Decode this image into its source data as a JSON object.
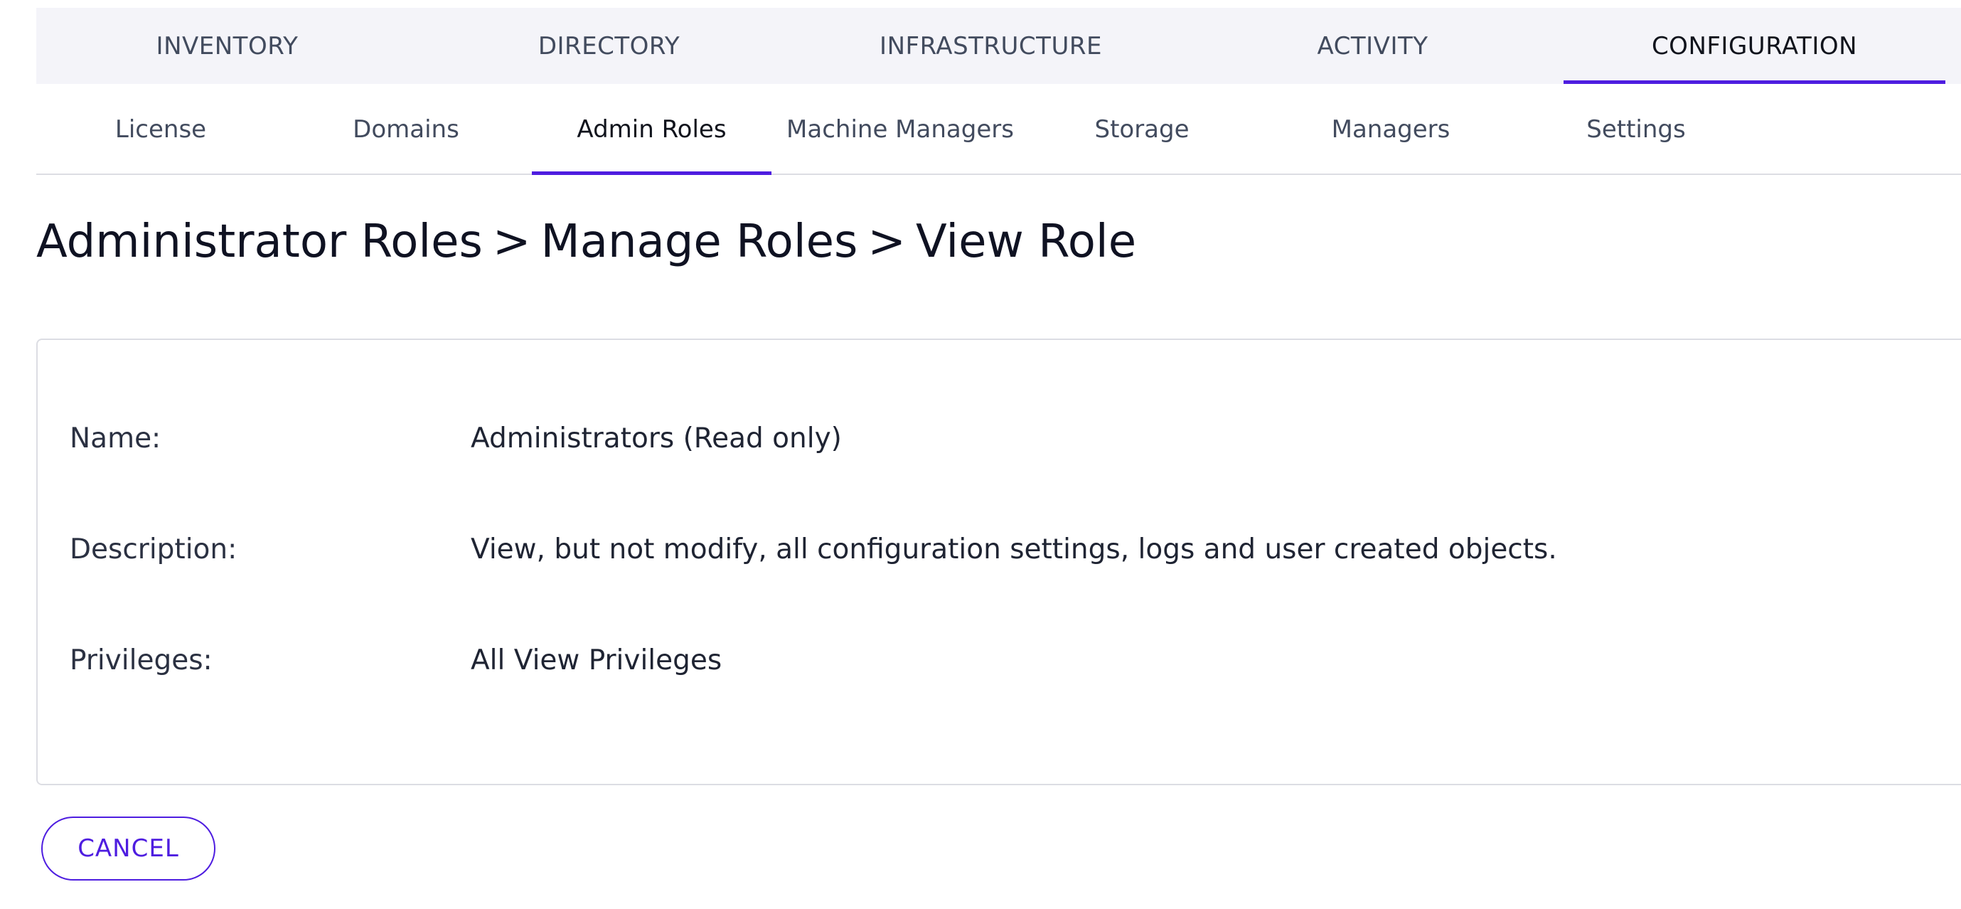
{
  "top_nav": {
    "items": [
      {
        "label": "INVENTORY"
      },
      {
        "label": "DIRECTORY"
      },
      {
        "label": "INFRASTRUCTURE"
      },
      {
        "label": "ACTIVITY"
      },
      {
        "label": "CONFIGURATION",
        "active": true
      }
    ]
  },
  "sub_nav": {
    "items": [
      {
        "label": "License"
      },
      {
        "label": "Domains"
      },
      {
        "label": "Admin Roles",
        "active": true
      },
      {
        "label": "Machine Managers"
      },
      {
        "label": "Storage"
      },
      {
        "label": "Managers"
      },
      {
        "label": "Settings"
      }
    ]
  },
  "breadcrumb": {
    "items": [
      "Administrator Roles",
      "Manage Roles",
      "View Role"
    ],
    "separator": ">"
  },
  "details": {
    "name_label": "Name:",
    "name_value": "Administrators (Read only)",
    "description_label": "Description:",
    "description_value": "View, but not modify, all configuration settings, logs and user created objects.",
    "privileges_label": "Privileges:",
    "privileges_value": "All View Privileges"
  },
  "actions": {
    "cancel_label": "CANCEL"
  },
  "colors": {
    "accent": "#4e1de0",
    "nav_background": "#f4f4f9",
    "border": "#dcdde3",
    "text": "#1f2433"
  }
}
